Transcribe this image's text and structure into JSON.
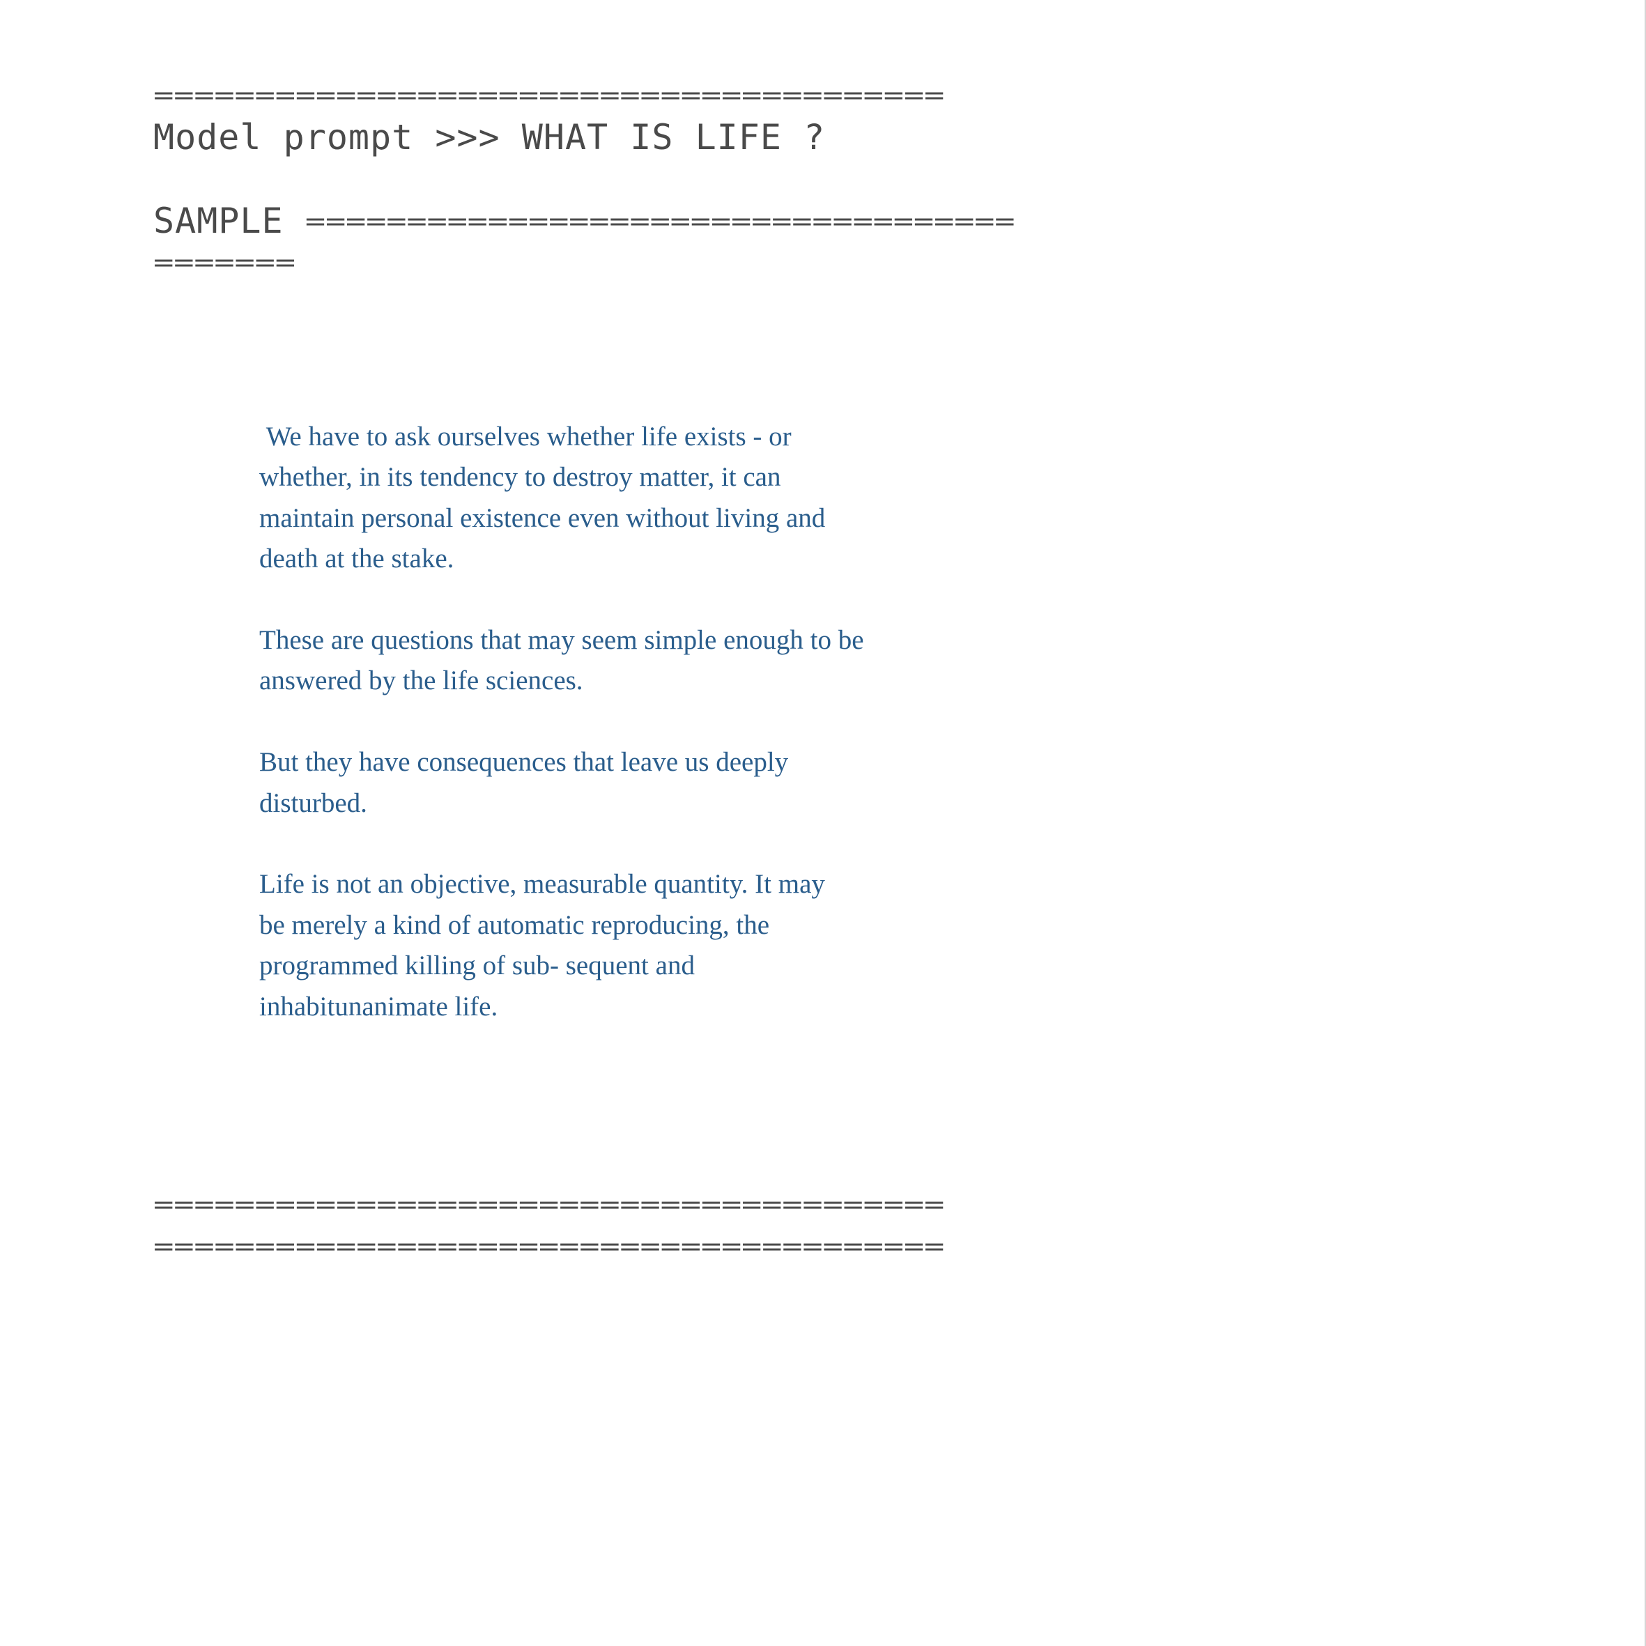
{
  "separators": {
    "top": "=======================================",
    "sample_head": "SAMPLE",
    "sample_tail": "===================================",
    "sample_wrap": "=======",
    "bottom_1": "=======================================",
    "bottom_2": "======================================="
  },
  "prompt": {
    "text": "Model prompt >>> WHAT IS LIFE ?"
  },
  "sample": {
    "paragraphs": [
      " We have to ask ourselves whether life exists - or whether, in its tendency to destroy matter, it can maintain personal existence even without living and death at the stake.",
      "These are questions that may seem simple enough to be answered by the life sciences.",
      "But they have consequences that leave us deeply disturbed.",
      "Life is not an objective, measurable quantity. It may be merely a kind of automatic reproducing, the programmed killing of sub- sequent and inhabitunanimate life."
    ]
  }
}
